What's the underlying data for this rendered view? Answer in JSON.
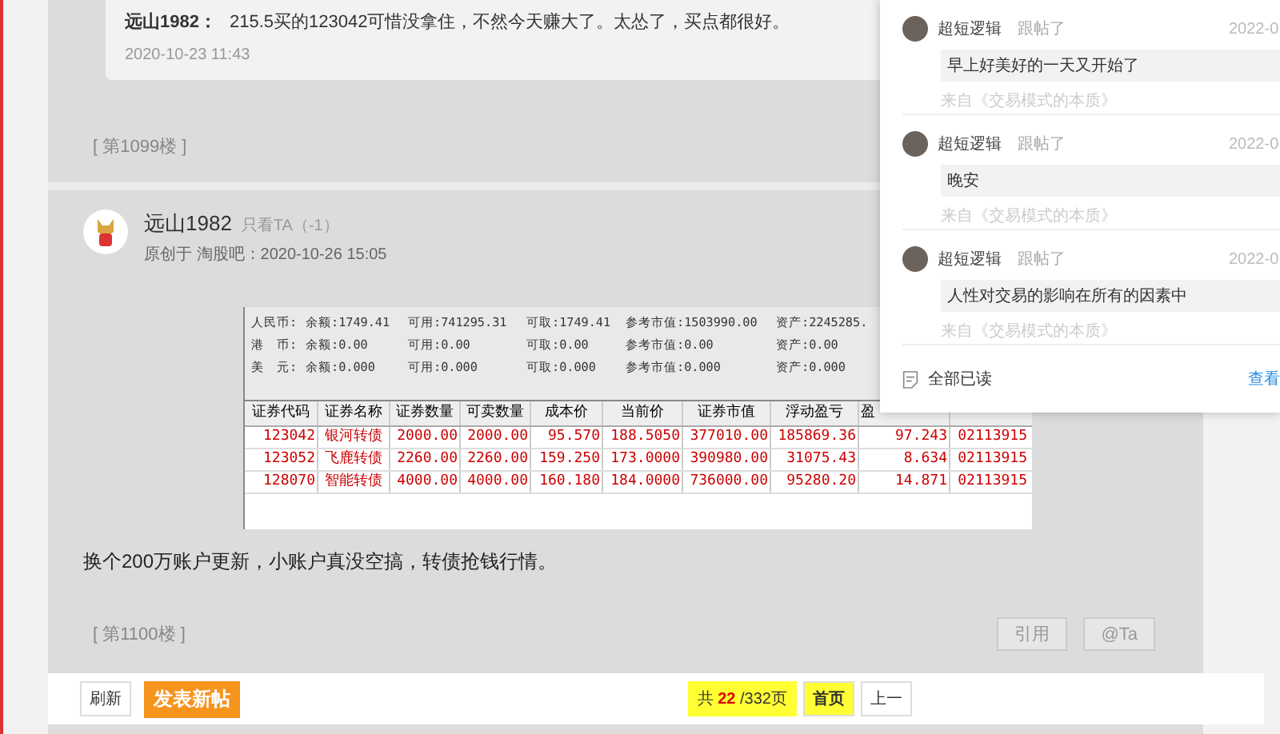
{
  "reply": {
    "author": "远山1982：",
    "text": "215.5买的123042可惜没拿住，不然今天赚大了。太怂了，买点都很好。",
    "time": "2020-10-23 11:43"
  },
  "floor_prev": "[ 第1099楼 ]",
  "post": {
    "author": "远山1982",
    "only_ta": "只看TA（-1）",
    "meta": "原创于 淘股吧：2020-10-26 15:05",
    "account_rows": [
      [
        "人民币:",
        "余额:1749.41",
        "可用:741295.31",
        "可取:1749.41",
        "参考市值:1503990.00",
        "资产:2245285."
      ],
      [
        "港　币:",
        "余额:0.00",
        "可用:0.00",
        "可取:0.00",
        "参考市值:0.00",
        "资产:0.00"
      ],
      [
        "美　元:",
        "余额:0.000",
        "可用:0.000",
        "可取:0.000",
        "参考市值:0.000",
        "资产:0.000"
      ]
    ],
    "holdings": {
      "columns": [
        "证券代码",
        "证券名称",
        "证券数量",
        "可卖数量",
        "成本价",
        "当前价",
        "证券市值",
        "浮动盈亏",
        "盈"
      ],
      "rows": [
        [
          "123042",
          "银河转债",
          "2000.00",
          "2000.00",
          "95.570",
          "188.5050",
          "377010.00",
          "185869.36",
          "97.243",
          "02113915"
        ],
        [
          "123052",
          "飞鹿转债",
          "2260.00",
          "2260.00",
          "159.250",
          "173.0000",
          "390980.00",
          "31075.43",
          "8.634",
          "02113915"
        ],
        [
          "128070",
          "智能转债",
          "4000.00",
          "4000.00",
          "160.180",
          "184.0000",
          "736000.00",
          "95280.20",
          "14.871",
          "02113915"
        ]
      ]
    },
    "text": "换个200万账户更新，小账户真没空搞，转债抢钱行情。",
    "floor": "[ 第1100楼 ]",
    "actions": [
      "引用",
      "@Ta"
    ]
  },
  "toolbar": {
    "refresh": "刷新",
    "new_post": "发表新帖",
    "page_prefix": "共",
    "page_current": "22",
    "page_total": "/332页",
    "first": "首页",
    "prev": "上一"
  },
  "notifications": {
    "items": [
      {
        "user": "超短逻辑",
        "action": "跟帖了",
        "time": "2022-0",
        "text": "早上好美好的一天又开始了",
        "source": "来自《交易模式的本质》"
      },
      {
        "user": "超短逻辑",
        "action": "跟帖了",
        "time": "2022-0",
        "text": "晚安",
        "source": "来自《交易模式的本质》"
      },
      {
        "user": "超短逻辑",
        "action": "跟帖了",
        "time": "2022-0",
        "text": "人性对交易的影响在所有的因素中",
        "source": "来自《交易模式的本质》"
      }
    ],
    "mark_all": "全部已读",
    "history": "查看"
  }
}
